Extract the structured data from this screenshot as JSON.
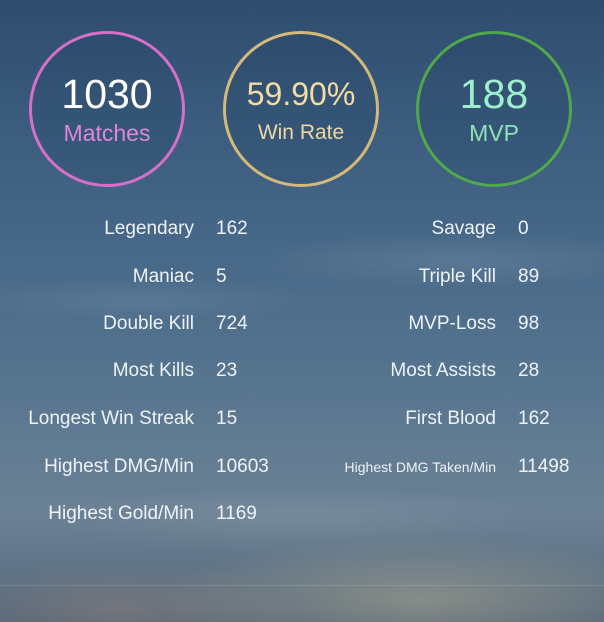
{
  "summary": {
    "matches": {
      "value": "1030",
      "label": "Matches"
    },
    "win_rate": {
      "value": "59.90%",
      "label": "Win Rate"
    },
    "mvp": {
      "value": "188",
      "label": "MVP"
    }
  },
  "stats": {
    "left": [
      {
        "label": "Legendary",
        "value": "162"
      },
      {
        "label": "Maniac",
        "value": "5"
      },
      {
        "label": "Double Kill",
        "value": "724"
      },
      {
        "label": "Most Kills",
        "value": "23"
      },
      {
        "label": "Longest Win Streak",
        "value": "15"
      },
      {
        "label": "Highest DMG/Min",
        "value": "10603"
      },
      {
        "label": "Highest Gold/Min",
        "value": "1169"
      }
    ],
    "right": [
      {
        "label": "Savage",
        "value": "0"
      },
      {
        "label": "Triple Kill",
        "value": "89"
      },
      {
        "label": "MVP-Loss",
        "value": "98"
      },
      {
        "label": "Most Assists",
        "value": "28"
      },
      {
        "label": "First Blood",
        "value": "162"
      },
      {
        "label": "Highest DMG Taken/Min",
        "value": "11498"
      }
    ]
  },
  "colors": {
    "matches_ring": "#d56fc9",
    "win_rate_ring": "#d5b97a",
    "mvp_ring": "#4fa84a"
  }
}
